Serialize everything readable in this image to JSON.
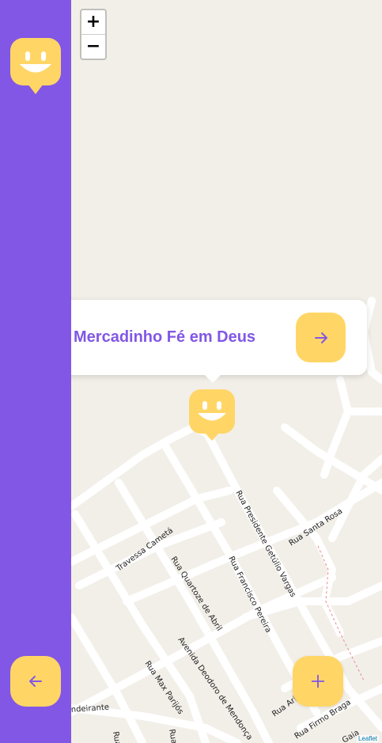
{
  "map": {
    "zoom_in_label": "+",
    "zoom_out_label": "−",
    "attribution": "Leaflet",
    "streets": [
      "Rua Presidente Getúlio Vargas",
      "Rua Santa Rosa",
      "Travessa Cametá",
      "Rua Quartoze de Abril",
      "Rua Francisco Pereira",
      "Avenida Deodoro de Mendonça",
      "Rua Max Parijós",
      "Rua Firmo Braga",
      "ndeirante",
      "Rua Ari",
      "Rua",
      "Rua",
      "Gaia"
    ]
  },
  "popup": {
    "title": "Mercadinho Fé em Deus"
  },
  "colors": {
    "sidebar": "#8257e5",
    "accent": "#ffd666",
    "map_bg": "#f2efe9"
  },
  "icons": {
    "logo": "smiley-marker-icon",
    "back": "arrow-left-icon",
    "popup_go": "arrow-right-icon",
    "add": "plus-icon"
  }
}
